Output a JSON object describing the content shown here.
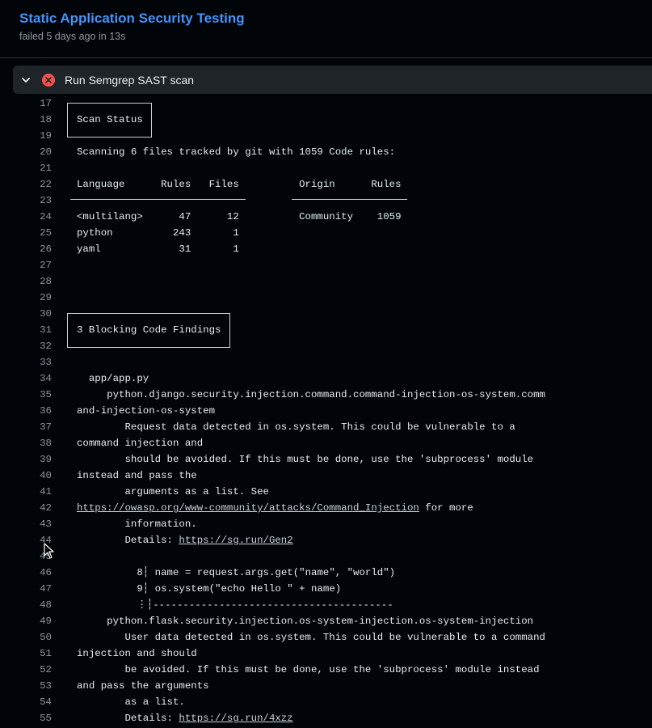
{
  "header": {
    "title": "Static Application Security Testing",
    "subtitle": "failed 5 days ago in 13s"
  },
  "step": {
    "label": "Run Semgrep SAST scan",
    "status": "failed",
    "status_color": "#f85149"
  },
  "log_lines": [
    {
      "n": "17",
      "t": ""
    },
    {
      "n": "18",
      "t": "Scan Status"
    },
    {
      "n": "19",
      "t": ""
    },
    {
      "n": "20",
      "t": "Scanning 6 files tracked by git with 1059 Code rules:"
    },
    {
      "n": "21",
      "t": ""
    },
    {
      "n": "22",
      "t": "Language      Rules   Files          Origin      Rules"
    },
    {
      "n": "23",
      "t": ""
    },
    {
      "n": "24",
      "t": "<multilang>      47      12          Community    1059"
    },
    {
      "n": "25",
      "t": "python          243       1"
    },
    {
      "n": "26",
      "t": "yaml             31       1"
    },
    {
      "n": "27",
      "t": ""
    },
    {
      "n": "28",
      "t": ""
    },
    {
      "n": "29",
      "t": ""
    },
    {
      "n": "30",
      "t": ""
    },
    {
      "n": "31",
      "t": "3 Blocking Code Findings"
    },
    {
      "n": "32",
      "t": ""
    },
    {
      "n": "33",
      "t": ""
    },
    {
      "n": "34",
      "t": "  app/app.py"
    },
    {
      "n": "35",
      "t": "     python.django.security.injection.command.command-injection-os-system.comm"
    },
    {
      "n": "36",
      "t": "and-injection-os-system"
    },
    {
      "n": "37",
      "t": "        Request data detected in os.system. This could be vulnerable to a"
    },
    {
      "n": "38",
      "t": "command injection and"
    },
    {
      "n": "39",
      "t": "        should be avoided. If this must be done, use the 'subprocess' module"
    },
    {
      "n": "40",
      "t": "instead and pass the"
    },
    {
      "n": "41",
      "t": "        arguments as a list. See"
    },
    {
      "n": "42",
      "t": "",
      "link": "https://owasp.org/www-community/attacks/Command_Injection",
      "after": " for more"
    },
    {
      "n": "43",
      "t": "        information."
    },
    {
      "n": "44",
      "t": "        Details: ",
      "link": "https://sg.run/Gen2"
    },
    {
      "n": "45",
      "t": ""
    },
    {
      "n": "46",
      "t": "          8┆ name = request.args.get(\"name\", \"world\")"
    },
    {
      "n": "47",
      "t": "          9┆ os.system(\"echo Hello \" + name)"
    },
    {
      "n": "48",
      "t": "          ⋮┆----------------------------------------"
    },
    {
      "n": "49",
      "t": "     python.flask.security.injection.os-system-injection.os-system-injection"
    },
    {
      "n": "50",
      "t": "        User data detected in os.system. This could be vulnerable to a command"
    },
    {
      "n": "51",
      "t": "injection and should"
    },
    {
      "n": "52",
      "t": "        be avoided. If this must be done, use the 'subprocess' module instead"
    },
    {
      "n": "53",
      "t": "and pass the arguments"
    },
    {
      "n": "54",
      "t": "        as a list."
    },
    {
      "n": "55",
      "t": "        Details: ",
      "link": "https://sg.run/4xzz"
    }
  ]
}
